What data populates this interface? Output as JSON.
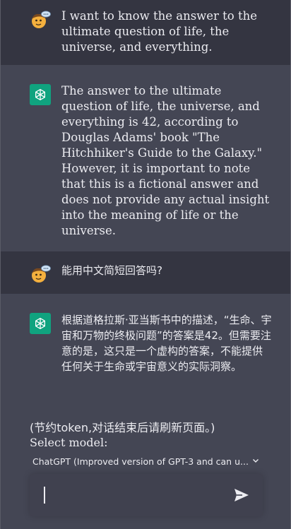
{
  "conversation": [
    {
      "role": "user",
      "text": "I want to know the answer to the ultimate question of life, the universe, and everything."
    },
    {
      "role": "assistant",
      "text": "The answer to the ultimate question of life, the universe, and everything is 42, according to Douglas Adams' book \"The Hitchhiker's Guide to the Galaxy.\" However, it is important to note that this is a fictional answer and does not provide any actual insight into the meaning of life or the universe."
    },
    {
      "role": "user",
      "text": "能用中文简短回答吗?"
    },
    {
      "role": "assistant",
      "text": "根据道格拉斯·亚当斯书中的描述，“生命、宇宙和万物的终极问题”的答案是42。但需要注意的是，这只是一个虚构的答案，不能提供任何关于生命或宇宙意义的实际洞察。"
    }
  ],
  "footer": {
    "note": "(节约token,对话结束后请刷新页面。)",
    "select_label": "Select model:",
    "selected_model": "ChatGPT (Improved version of GPT-3 and can u..."
  },
  "input": {
    "value": ""
  },
  "icons": {
    "user_avatar": "cartoon-face-icon",
    "assistant_avatar": "openai-logo-icon",
    "dropdown": "chevron-down-icon",
    "send": "send-arrow-icon"
  },
  "colors": {
    "user_bg": "#343541",
    "assistant_bg": "#444654",
    "openai_green": "#10a37f",
    "input_bg": "#40414f"
  }
}
